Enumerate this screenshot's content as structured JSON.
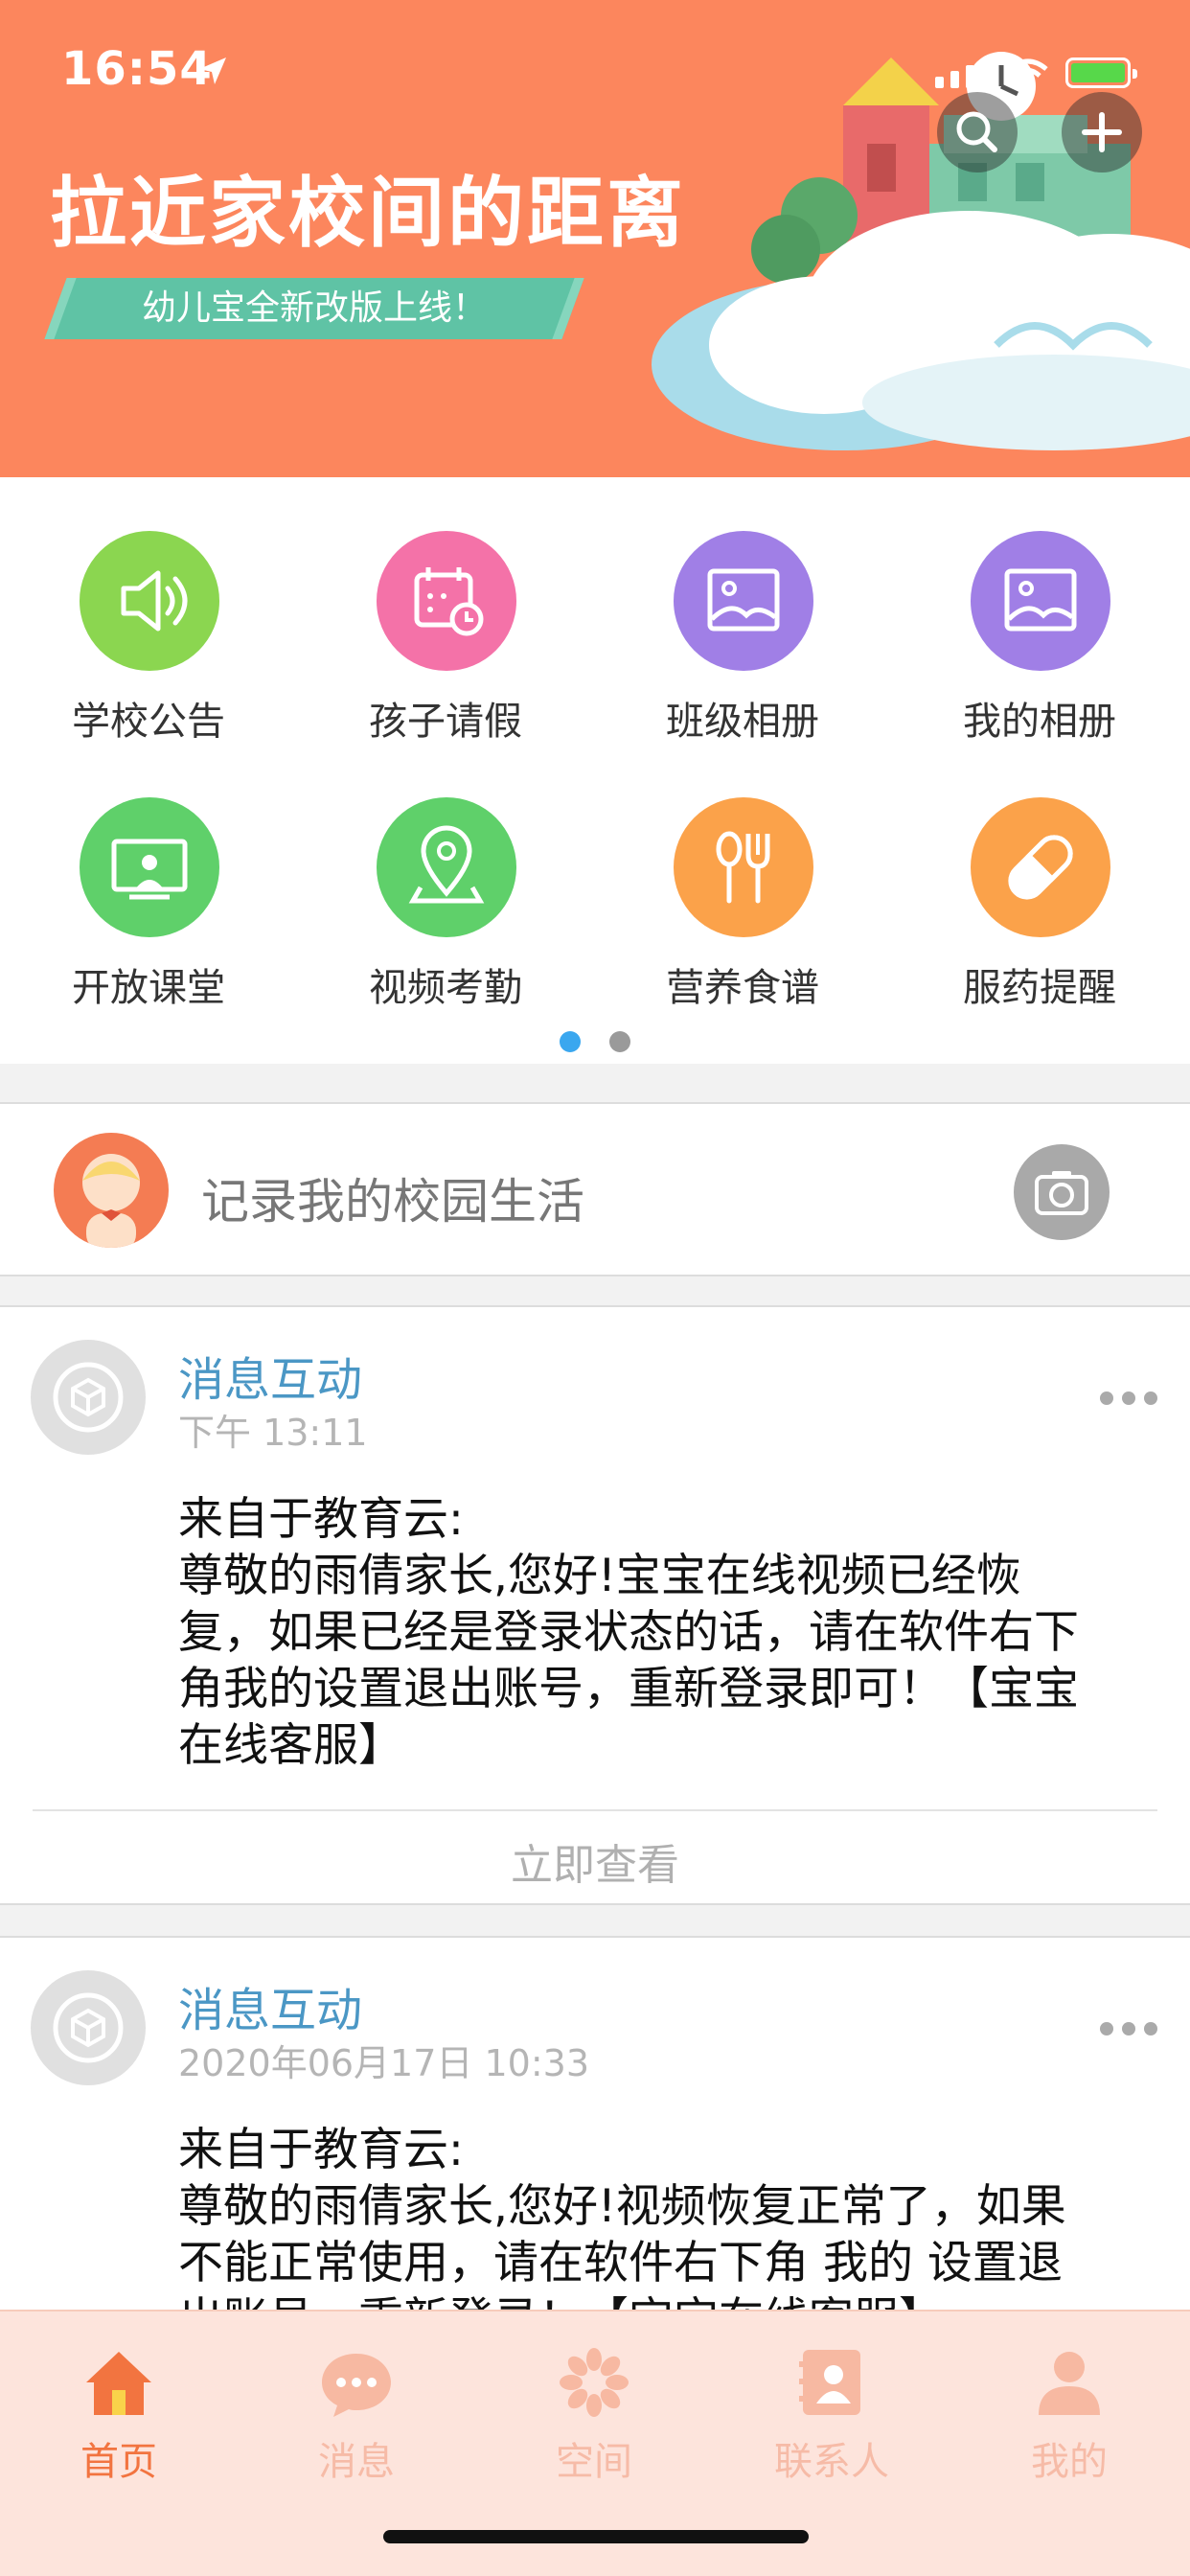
{
  "status_bar": {
    "time": "16:54"
  },
  "banner": {
    "title": "拉近家校间的距离",
    "subtitle": "幼儿宝全新改版上线！"
  },
  "header_actions": {
    "search_icon": "search-icon",
    "add_icon": "plus-icon"
  },
  "quick_grid": {
    "items": [
      {
        "label": "学校公告",
        "icon": "speaker-icon",
        "color": "#8bd650"
      },
      {
        "label": "孩子请假",
        "icon": "calendar-clock-icon",
        "color": "#f472a8"
      },
      {
        "label": "班级相册",
        "icon": "photo-icon",
        "color": "#a07fe6"
      },
      {
        "label": "我的相册",
        "icon": "photo-icon",
        "color": "#a07fe6"
      },
      {
        "label": "开放课堂",
        "icon": "classroom-screen-icon",
        "color": "#5fd06a"
      },
      {
        "label": "视频考勤",
        "icon": "location-pin-icon",
        "color": "#5fd06a"
      },
      {
        "label": "营养食谱",
        "icon": "spoon-fork-icon",
        "color": "#fba24a"
      },
      {
        "label": "服药提醒",
        "icon": "pill-icon",
        "color": "#fba24a"
      }
    ],
    "page_indicator": {
      "current": 1,
      "total": 2
    }
  },
  "record_bar": {
    "placeholder": "记录我的校园生活"
  },
  "feed": [
    {
      "title": "消息互动",
      "time": "下午 13:11",
      "body_lines": [
        "来自于教育云:",
        "尊敬的雨倩家长,您好!宝宝在线视频已经恢",
        "复，如果已经是登录状态的话，请在软件右下",
        "角我的设置退出账号，重新登录即可！【宝宝",
        "在线客服】"
      ],
      "action": "立即查看"
    },
    {
      "title": "消息互动",
      "time": "2020年06月17日 10:33",
      "body_lines": [
        "来自于教育云:",
        "尊敬的雨倩家长,您好!视频恢复正常了，如果",
        "不能正常使用，请在软件右下角 我的 设置退",
        "出账号，重新登录！【宝宝在线客服】"
      ]
    }
  ],
  "tab_bar": {
    "tabs": [
      {
        "label": "首页",
        "icon": "home-icon",
        "active": true
      },
      {
        "label": "消息",
        "icon": "chat-bubble-icon",
        "active": false
      },
      {
        "label": "空间",
        "icon": "flower-icon",
        "active": false
      },
      {
        "label": "联系人",
        "icon": "contacts-book-icon",
        "active": false
      },
      {
        "label": "我的",
        "icon": "person-icon",
        "active": false
      }
    ]
  },
  "colors": {
    "banner": "#fc865d",
    "accent": "#f27440",
    "link": "#4b97c5",
    "tabbar_bg": "#fde4dc"
  }
}
